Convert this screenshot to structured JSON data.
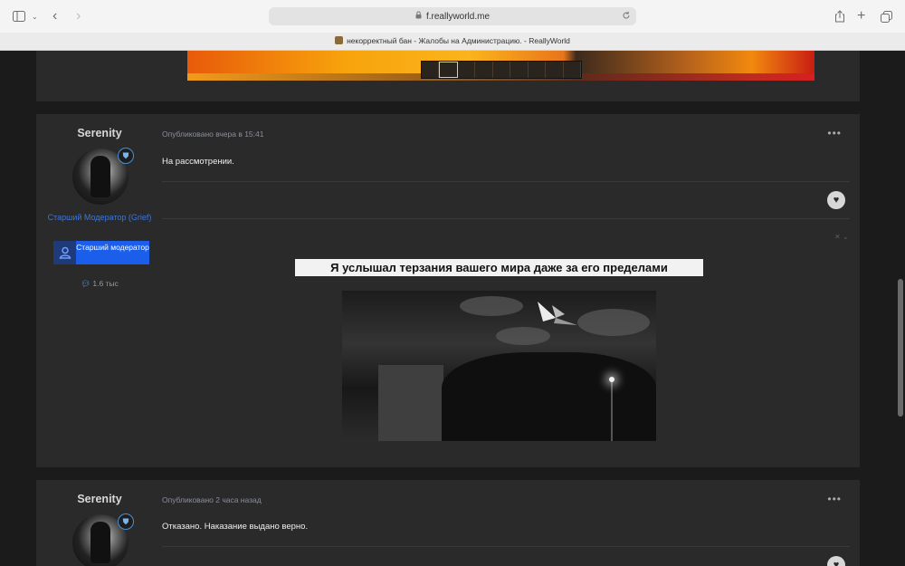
{
  "browser": {
    "url": "f.reallyworld.me",
    "tab_title": "некорректный бан - Жалобы на Администрацию. - ReallyWorld"
  },
  "posts": [
    {
      "author": "Serenity",
      "role": "Старший Модератор (Grief)",
      "badge": "Старший модератор",
      "post_count": "1.6 тыс",
      "meta": "Опубликовано вчера в 15:41",
      "body": "На рассмотрении.",
      "signature_heading": "Я услышал терзания вашего мира даже за его пределами"
    },
    {
      "author": "Serenity",
      "meta": "Опубликовано 2 часа назад",
      "body": "Отказано. Наказание выдано верно."
    }
  ],
  "icons": {
    "sidebar": "sidebar-icon",
    "back": "chevron-left-icon",
    "forward": "chevron-right-icon",
    "lock": "lock-icon",
    "reload": "reload-icon",
    "share": "share-icon",
    "new_tab": "plus-icon",
    "tabs": "tabs-overview-icon",
    "more": "ellipsis-icon",
    "like": "heart-icon",
    "comment": "speech-bubble-icon"
  },
  "colors": {
    "accent": "#1a5eea",
    "role_text": "#3e76d4"
  }
}
